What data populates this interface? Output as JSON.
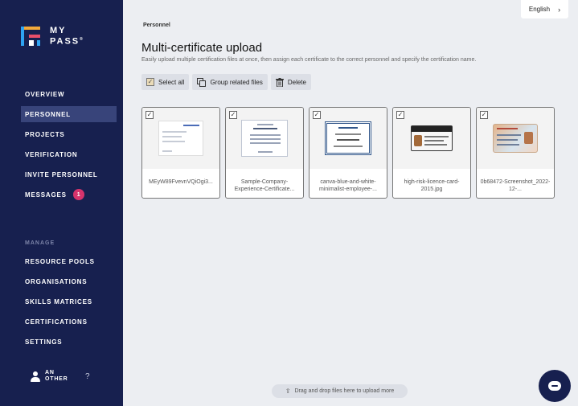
{
  "brand": {
    "line1": "MY",
    "line2": "PASS",
    "mark": "®",
    "colors": [
      "#f2a93b",
      "#2ea3f2",
      "#e94f6a",
      "#ffffff"
    ]
  },
  "nav": {
    "items": [
      {
        "label": "OVERVIEW"
      },
      {
        "label": "PERSONNEL"
      },
      {
        "label": "PROJECTS"
      },
      {
        "label": "VERIFICATION"
      },
      {
        "label": "INVITE PERSONNEL"
      },
      {
        "label": "MESSAGES",
        "badge": "1"
      }
    ],
    "manage_label": "MANAGE",
    "manage_items": [
      {
        "label": "RESOURCE POOLS"
      },
      {
        "label": "ORGANISATIONS"
      },
      {
        "label": "SKILLS MATRICES"
      },
      {
        "label": "CERTIFICATIONS"
      },
      {
        "label": "SETTINGS"
      }
    ],
    "user": {
      "name": "AN OTHER",
      "help": "?"
    }
  },
  "language": {
    "label": "English",
    "chevron": "›"
  },
  "page": {
    "breadcrumb": "Personnel",
    "title": "Multi-certificate upload",
    "subtitle": "Easily upload multiple certification files at once, then assign each certificate to the correct personnel and specify the certification name."
  },
  "toolbar": {
    "select_all": "Select all",
    "group_related": "Group related files",
    "delete": "Delete"
  },
  "files": [
    {
      "name": "MEyW89FvevnVQiOgi3...",
      "checked": true,
      "thumb": "document"
    },
    {
      "name": "Sample-Company-Experience-Certificate...",
      "checked": true,
      "thumb": "certificate"
    },
    {
      "name": "canva-blue-and-white-minimalist-employee-...",
      "checked": true,
      "thumb": "framed-certificate"
    },
    {
      "name": "high-risk-licence-card-2015.jpg",
      "checked": true,
      "thumb": "licence-card"
    },
    {
      "name": "0b68472-Screenshot_2022-12-...",
      "checked": true,
      "thumb": "id-card"
    }
  ],
  "dropzone": {
    "label": "Drag and drop files here to upload more"
  },
  "colors": {
    "sidebar": "#17204f",
    "active": "#38447a",
    "badge": "#d6336c",
    "background": "#eceef2"
  }
}
